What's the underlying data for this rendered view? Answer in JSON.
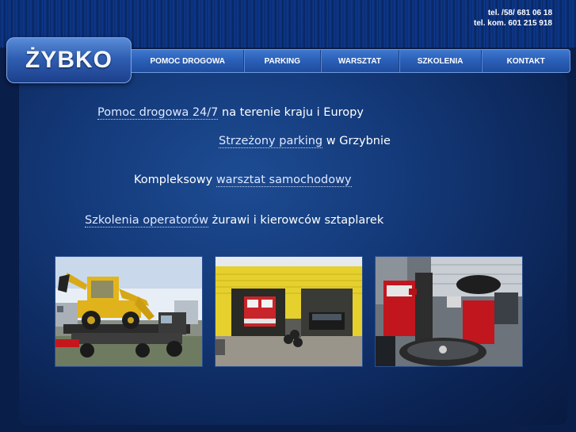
{
  "header": {
    "phone": "tel. /58/ 681 06 18",
    "mobile": "tel. kom. 601 215 918",
    "logo_text": "ŻYBKO"
  },
  "nav": {
    "items": [
      {
        "label": "POMOC DROGOWA"
      },
      {
        "label": "PARKING"
      },
      {
        "label": "WARSZTAT"
      },
      {
        "label": "SZKOLENIA"
      },
      {
        "label": "KONTAKT"
      }
    ]
  },
  "content": {
    "line1": {
      "link": "Pomoc drogowa 24/7",
      "text": " na terenie kraju i Europy"
    },
    "line2": {
      "link": "Strzeżony parking",
      "text": " w Grzybnie"
    },
    "line3": {
      "text": "Kompleksowy ",
      "link": "warsztat samochodowy"
    },
    "line4": {
      "link": "Szkolenia operatorów",
      "text": " żurawi i kierowców sztaplarek"
    }
  },
  "photos": [
    {
      "name": "tow-truck-with-excavator"
    },
    {
      "name": "garage-with-fire-truck"
    },
    {
      "name": "tire-service-workshop"
    }
  ]
}
